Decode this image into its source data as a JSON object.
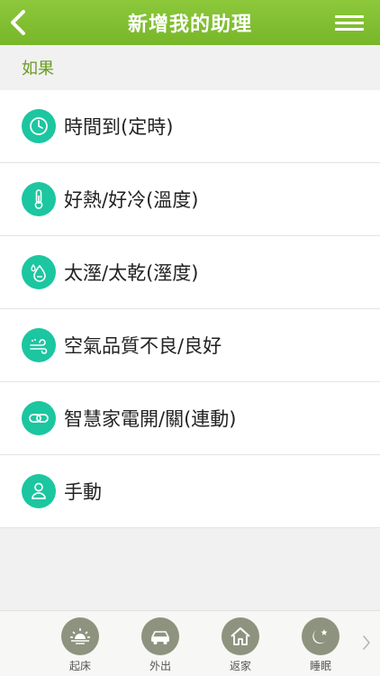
{
  "header": {
    "title": "新增我的助理"
  },
  "section": {
    "label": "如果"
  },
  "triggers": [
    {
      "icon": "clock-icon",
      "label": "時間到(定時)"
    },
    {
      "icon": "thermometer-icon",
      "label": "好熱/好冷(溫度)"
    },
    {
      "icon": "humidity-icon",
      "label": "太溼/太乾(溼度)"
    },
    {
      "icon": "air-quality-icon",
      "label": "空氣品質不良/良好"
    },
    {
      "icon": "link-icon",
      "label": "智慧家電開/關(連動)"
    },
    {
      "icon": "person-icon",
      "label": "手動"
    }
  ],
  "scenes": [
    {
      "icon": "sunrise-icon",
      "label": "起床"
    },
    {
      "icon": "car-icon",
      "label": "外出"
    },
    {
      "icon": "home-icon",
      "label": "返家"
    },
    {
      "icon": "moon-icon",
      "label": "睡眠"
    }
  ],
  "colors": {
    "header": "#80bd30",
    "accent_icon": "#1cc6a0",
    "section_text": "#6a9a22",
    "scene_icon": "#8e937f"
  }
}
